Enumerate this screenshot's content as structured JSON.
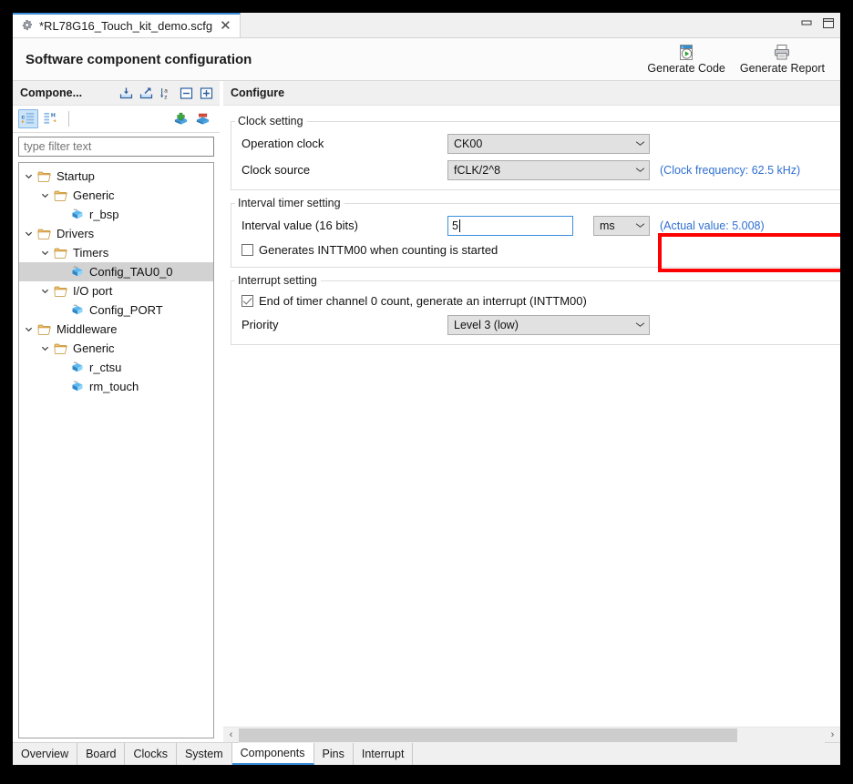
{
  "window": {
    "minimize_label": "minimize",
    "maximize_label": "maximize"
  },
  "editor_tab": {
    "icon": "gear-icon",
    "title": "*RL78G16_Touch_kit_demo.scfg",
    "close": "✕"
  },
  "header": {
    "title": "Software component configuration",
    "actions": [
      {
        "id": "generate-code",
        "label": "Generate Code",
        "icon": "generate-code-icon"
      },
      {
        "id": "generate-report",
        "label": "Generate Report",
        "icon": "printer-icon"
      }
    ]
  },
  "components_panel": {
    "title": "Compone...",
    "header_icons": [
      {
        "id": "import",
        "name": "import-icon"
      },
      {
        "id": "export",
        "name": "export-icon"
      },
      {
        "id": "sort",
        "name": "sort-az-icon"
      },
      {
        "id": "collapse-all",
        "name": "collapse-all-icon"
      },
      {
        "id": "expand-all",
        "name": "expand-all-icon"
      }
    ],
    "toolbar_icons": [
      {
        "id": "view-hardware",
        "name": "hardware-view-icon",
        "selected": true
      },
      {
        "id": "view-software",
        "name": "software-view-icon",
        "selected": false
      },
      {
        "id": "add-component",
        "name": "add-component-icon"
      },
      {
        "id": "remove-component",
        "name": "remove-component-icon"
      }
    ],
    "filter": {
      "placeholder": "type filter text",
      "value": ""
    },
    "tree": [
      {
        "label": "Startup",
        "depth": 0,
        "type": "folder",
        "expanded": true,
        "selected": false
      },
      {
        "label": "Generic",
        "depth": 1,
        "type": "folder",
        "expanded": true,
        "selected": false
      },
      {
        "label": "r_bsp",
        "depth": 2,
        "type": "component",
        "expanded": null,
        "selected": false
      },
      {
        "label": "Drivers",
        "depth": 0,
        "type": "folder",
        "expanded": true,
        "selected": false
      },
      {
        "label": "Timers",
        "depth": 1,
        "type": "folder",
        "expanded": true,
        "selected": false
      },
      {
        "label": "Config_TAU0_0",
        "depth": 2,
        "type": "component",
        "expanded": null,
        "selected": true
      },
      {
        "label": "I/O port",
        "depth": 1,
        "type": "folder",
        "expanded": true,
        "selected": false
      },
      {
        "label": "Config_PORT",
        "depth": 2,
        "type": "component",
        "expanded": null,
        "selected": false
      },
      {
        "label": "Middleware",
        "depth": 0,
        "type": "folder",
        "expanded": true,
        "selected": false
      },
      {
        "label": "Generic",
        "depth": 1,
        "type": "folder",
        "expanded": true,
        "selected": false
      },
      {
        "label": "r_ctsu",
        "depth": 2,
        "type": "component",
        "expanded": null,
        "selected": false
      },
      {
        "label": "rm_touch",
        "depth": 2,
        "type": "component",
        "expanded": null,
        "selected": false
      }
    ]
  },
  "configure": {
    "title": "Configure",
    "clock_setting": {
      "legend": "Clock setting",
      "operation_clock": {
        "label": "Operation clock",
        "value": "CK00"
      },
      "clock_source": {
        "label": "Clock source",
        "value": "fCLK/2^8",
        "note": "(Clock frequency: 62.5 kHz)"
      }
    },
    "interval_timer_setting": {
      "legend": "Interval timer setting",
      "interval_value": {
        "label": "Interval value (16 bits)",
        "value": "5",
        "unit": "ms",
        "note": "(Actual value: 5.008)"
      },
      "generates_inttm00": {
        "label": "Generates INTTM00 when counting is started",
        "checked": false
      }
    },
    "interrupt_setting": {
      "legend": "Interrupt setting",
      "end_of_timer": {
        "label": "End of timer channel 0 count, generate an interrupt (INTTM00)",
        "checked": true
      },
      "priority": {
        "label": "Priority",
        "value": "Level 3 (low)"
      }
    }
  },
  "scrollbar": {
    "left_arrow": "‹",
    "right_arrow": "›",
    "thumb_percent": 85
  },
  "bottom_tabs": [
    {
      "label": "Overview",
      "active": false
    },
    {
      "label": "Board",
      "active": false
    },
    {
      "label": "Clocks",
      "active": false
    },
    {
      "label": "System",
      "active": false
    },
    {
      "label": "Components",
      "active": true
    },
    {
      "label": "Pins",
      "active": false
    },
    {
      "label": "Interrupt",
      "active": false
    }
  ],
  "colors": {
    "accent": "#3c8edc",
    "annotation": "#fe0000",
    "note_text": "#2f6fd0",
    "selection": "#d2d2d2"
  }
}
